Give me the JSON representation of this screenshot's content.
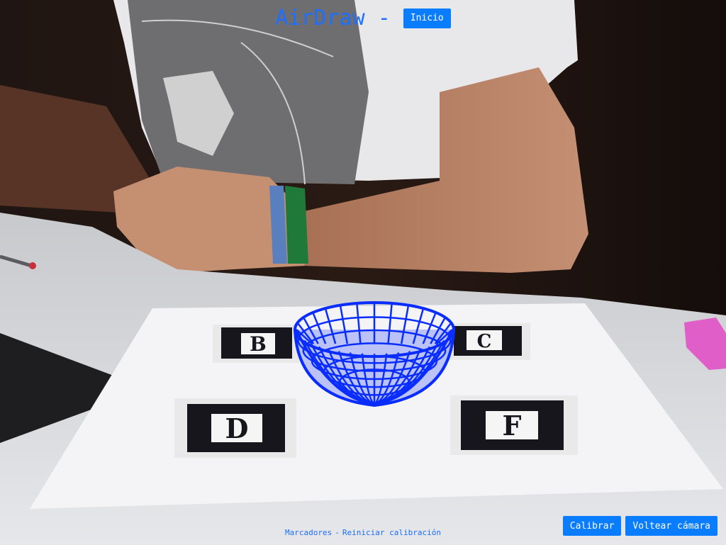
{
  "header": {
    "title": "AirDraw -",
    "home_label": "Inicio"
  },
  "markers": {
    "labels": [
      "B",
      "C",
      "D",
      "F"
    ]
  },
  "footer": {
    "markers_link": "Marcadores",
    "separator": "-",
    "reset_link": "Reiniciar calibración"
  },
  "actions": {
    "calibrate_label": "Calibrar",
    "flip_label": "Voltear cámara"
  },
  "colors": {
    "accent": "#0a7dff",
    "title": "#1e6eff",
    "mesh": "#0a2dff"
  },
  "icons": {
    "ar_object": "wireframe-bowl-icon"
  }
}
